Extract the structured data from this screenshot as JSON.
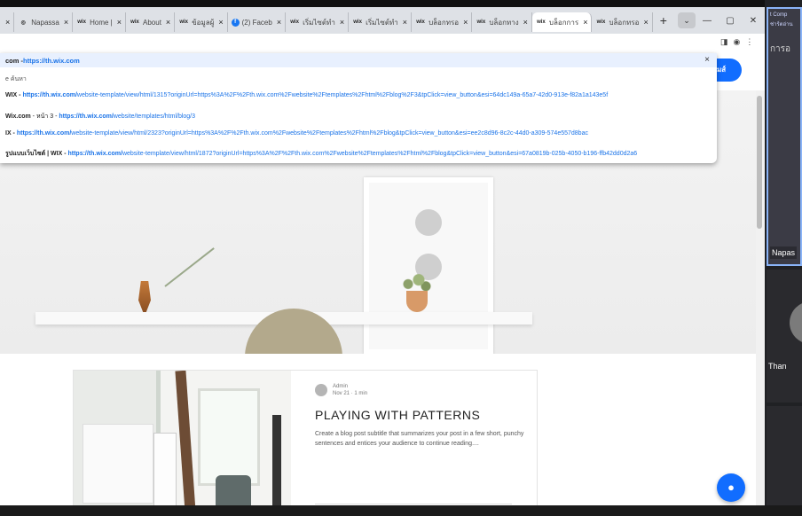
{
  "tabs": [
    {
      "icon": "",
      "label": ""
    },
    {
      "icon": "globe",
      "label": "Napassa"
    },
    {
      "icon": "wix",
      "label": "Home | "
    },
    {
      "icon": "wix",
      "label": "About"
    },
    {
      "icon": "wix",
      "label": "ข้อมูลผู้"
    },
    {
      "icon": "facebook",
      "label": "(2) Faceb"
    },
    {
      "icon": "wix",
      "label": "เริ่มไซต์ทำ"
    },
    {
      "icon": "wix",
      "label": "เริ่มไซต์ทำ"
    },
    {
      "icon": "wix",
      "label": "บล็อกทรอ"
    },
    {
      "icon": "wix",
      "label": "บล็อกทาง"
    },
    {
      "icon": "wix",
      "label": "บล็อกการ"
    },
    {
      "icon": "wix",
      "label": "บล็อกทรอ"
    }
  ],
  "tab_icon_glyphs": {
    "globe": "◎",
    "wix": "wix",
    "facebook": "f"
  },
  "tab_close": "×",
  "new_tab": "+",
  "tab_search": "⌄",
  "window_controls": {
    "minimize": "—",
    "maximize": "▢",
    "close": "✕"
  },
  "toolbar_icons": {
    "panel": "◨",
    "profile": "◉",
    "menu": "⋮"
  },
  "omnibox": {
    "bold": "com - ",
    "url": "https://th.wix.com",
    "clear": "×"
  },
  "suggestions": [
    {
      "plain": "e ค้นหา"
    },
    {
      "bold": "WIX - ",
      "url_bold": "https://th.wix.com/",
      "url_rest": "website-template/view/html/1315?originUrl=https%3A%2F%2Fth.wix.com%2Fwebsite%2Ftemplates%2Fhtml%2Fblog%2F3&tpClick=view_button&esi=64dc149a-65a7-42d0-913e-f82a1a143e5f"
    },
    {
      "bold": "Wix.com",
      "mid": " - หน้า 3 - ",
      "url_bold": "https://th.wix.com/",
      "url_rest": "website/templates/html/blog/3"
    },
    {
      "bold": "IX - ",
      "url_bold": "https://th.wix.com/",
      "url_rest": "website-template/view/html/2323?originUrl=https%3A%2F%2Fth.wix.com%2Fwebsite%2Ftemplates%2Fhtml%2Fblog&tpClick=view_button&esi=ee2c8d96-8c2c-44d0-a309-574e557d8bac"
    },
    {
      "bold": "รูปแบบเว็บไซต์ | WIX - ",
      "url_bold": "https://th.wix.com/",
      "url_rest": "website-template/view/html/1872?originUrl=https%3A%2F%2Fth.wix.com%2Fwebsite%2Ftemplates%2Fhtml%2Fblog&tpClick=view_button&esi=67a0819b-025b-4050-b196-ffb42dd0d2a6"
    }
  ],
  "signup_label": "มส์",
  "post": {
    "author": "Admin",
    "date": "Nov 21",
    "read_time": "1 min",
    "dot": "·",
    "title": "PLAYING WITH PATTERNS",
    "excerpt": "Create a blog post subtitle that summarizes your post in a few short, punchy sentences and entices your audience to continue reading...."
  },
  "chat_icon": "●",
  "meeting": {
    "tile1_top": "t Comp",
    "tile1_top2": "ช่าร์ตอ่าน",
    "tile1_label": "การอ",
    "tile1_name": "Napas",
    "tile2_name": "Than"
  }
}
